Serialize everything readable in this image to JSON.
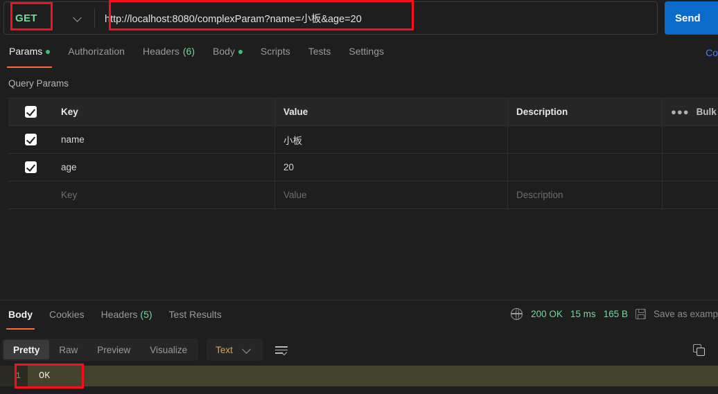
{
  "request": {
    "method": "GET",
    "url": "http://localhost:8080/complexParam?name=小板&age=20",
    "send_label": "Send",
    "tabs": [
      {
        "label": "Params",
        "dot": true,
        "count": ""
      },
      {
        "label": "Authorization",
        "dot": false,
        "count": ""
      },
      {
        "label": "Headers",
        "dot": false,
        "count": "(6)"
      },
      {
        "label": "Body",
        "dot": true,
        "count": ""
      },
      {
        "label": "Scripts",
        "dot": false,
        "count": ""
      },
      {
        "label": "Tests",
        "dot": false,
        "count": ""
      },
      {
        "label": "Settings",
        "dot": false,
        "count": ""
      }
    ],
    "console_link": "Co"
  },
  "query_params": {
    "title": "Query Params",
    "columns": {
      "key": "Key",
      "value": "Value",
      "description": "Description"
    },
    "bulk_edit_label": "Bulk",
    "rows": [
      {
        "checked": true,
        "key": "name",
        "value": "小板",
        "description": ""
      },
      {
        "checked": true,
        "key": "age",
        "value": "20",
        "description": ""
      }
    ],
    "placeholder_row": {
      "key": "Key",
      "value": "Value",
      "description": "Description"
    }
  },
  "response": {
    "tabs": [
      {
        "label": "Body",
        "count": ""
      },
      {
        "label": "Cookies",
        "count": ""
      },
      {
        "label": "Headers",
        "count": "(5)"
      },
      {
        "label": "Test Results",
        "count": ""
      }
    ],
    "status": "200 OK",
    "time": "15 ms",
    "size": "165 B",
    "save_as_example": "Save as examp",
    "view_modes": [
      "Pretty",
      "Raw",
      "Preview",
      "Visualize"
    ],
    "active_view": "Pretty",
    "format": "Text",
    "body_lines": [
      {
        "number": "1",
        "text": "OK"
      }
    ]
  },
  "colors": {
    "accent": "#ff6c37",
    "method_green": "#6bdd9a",
    "send_blue": "#0b6bcb",
    "annotation_red": "#fc0d1c",
    "format_orange": "#e8a33d",
    "highlight": "#44442e"
  }
}
